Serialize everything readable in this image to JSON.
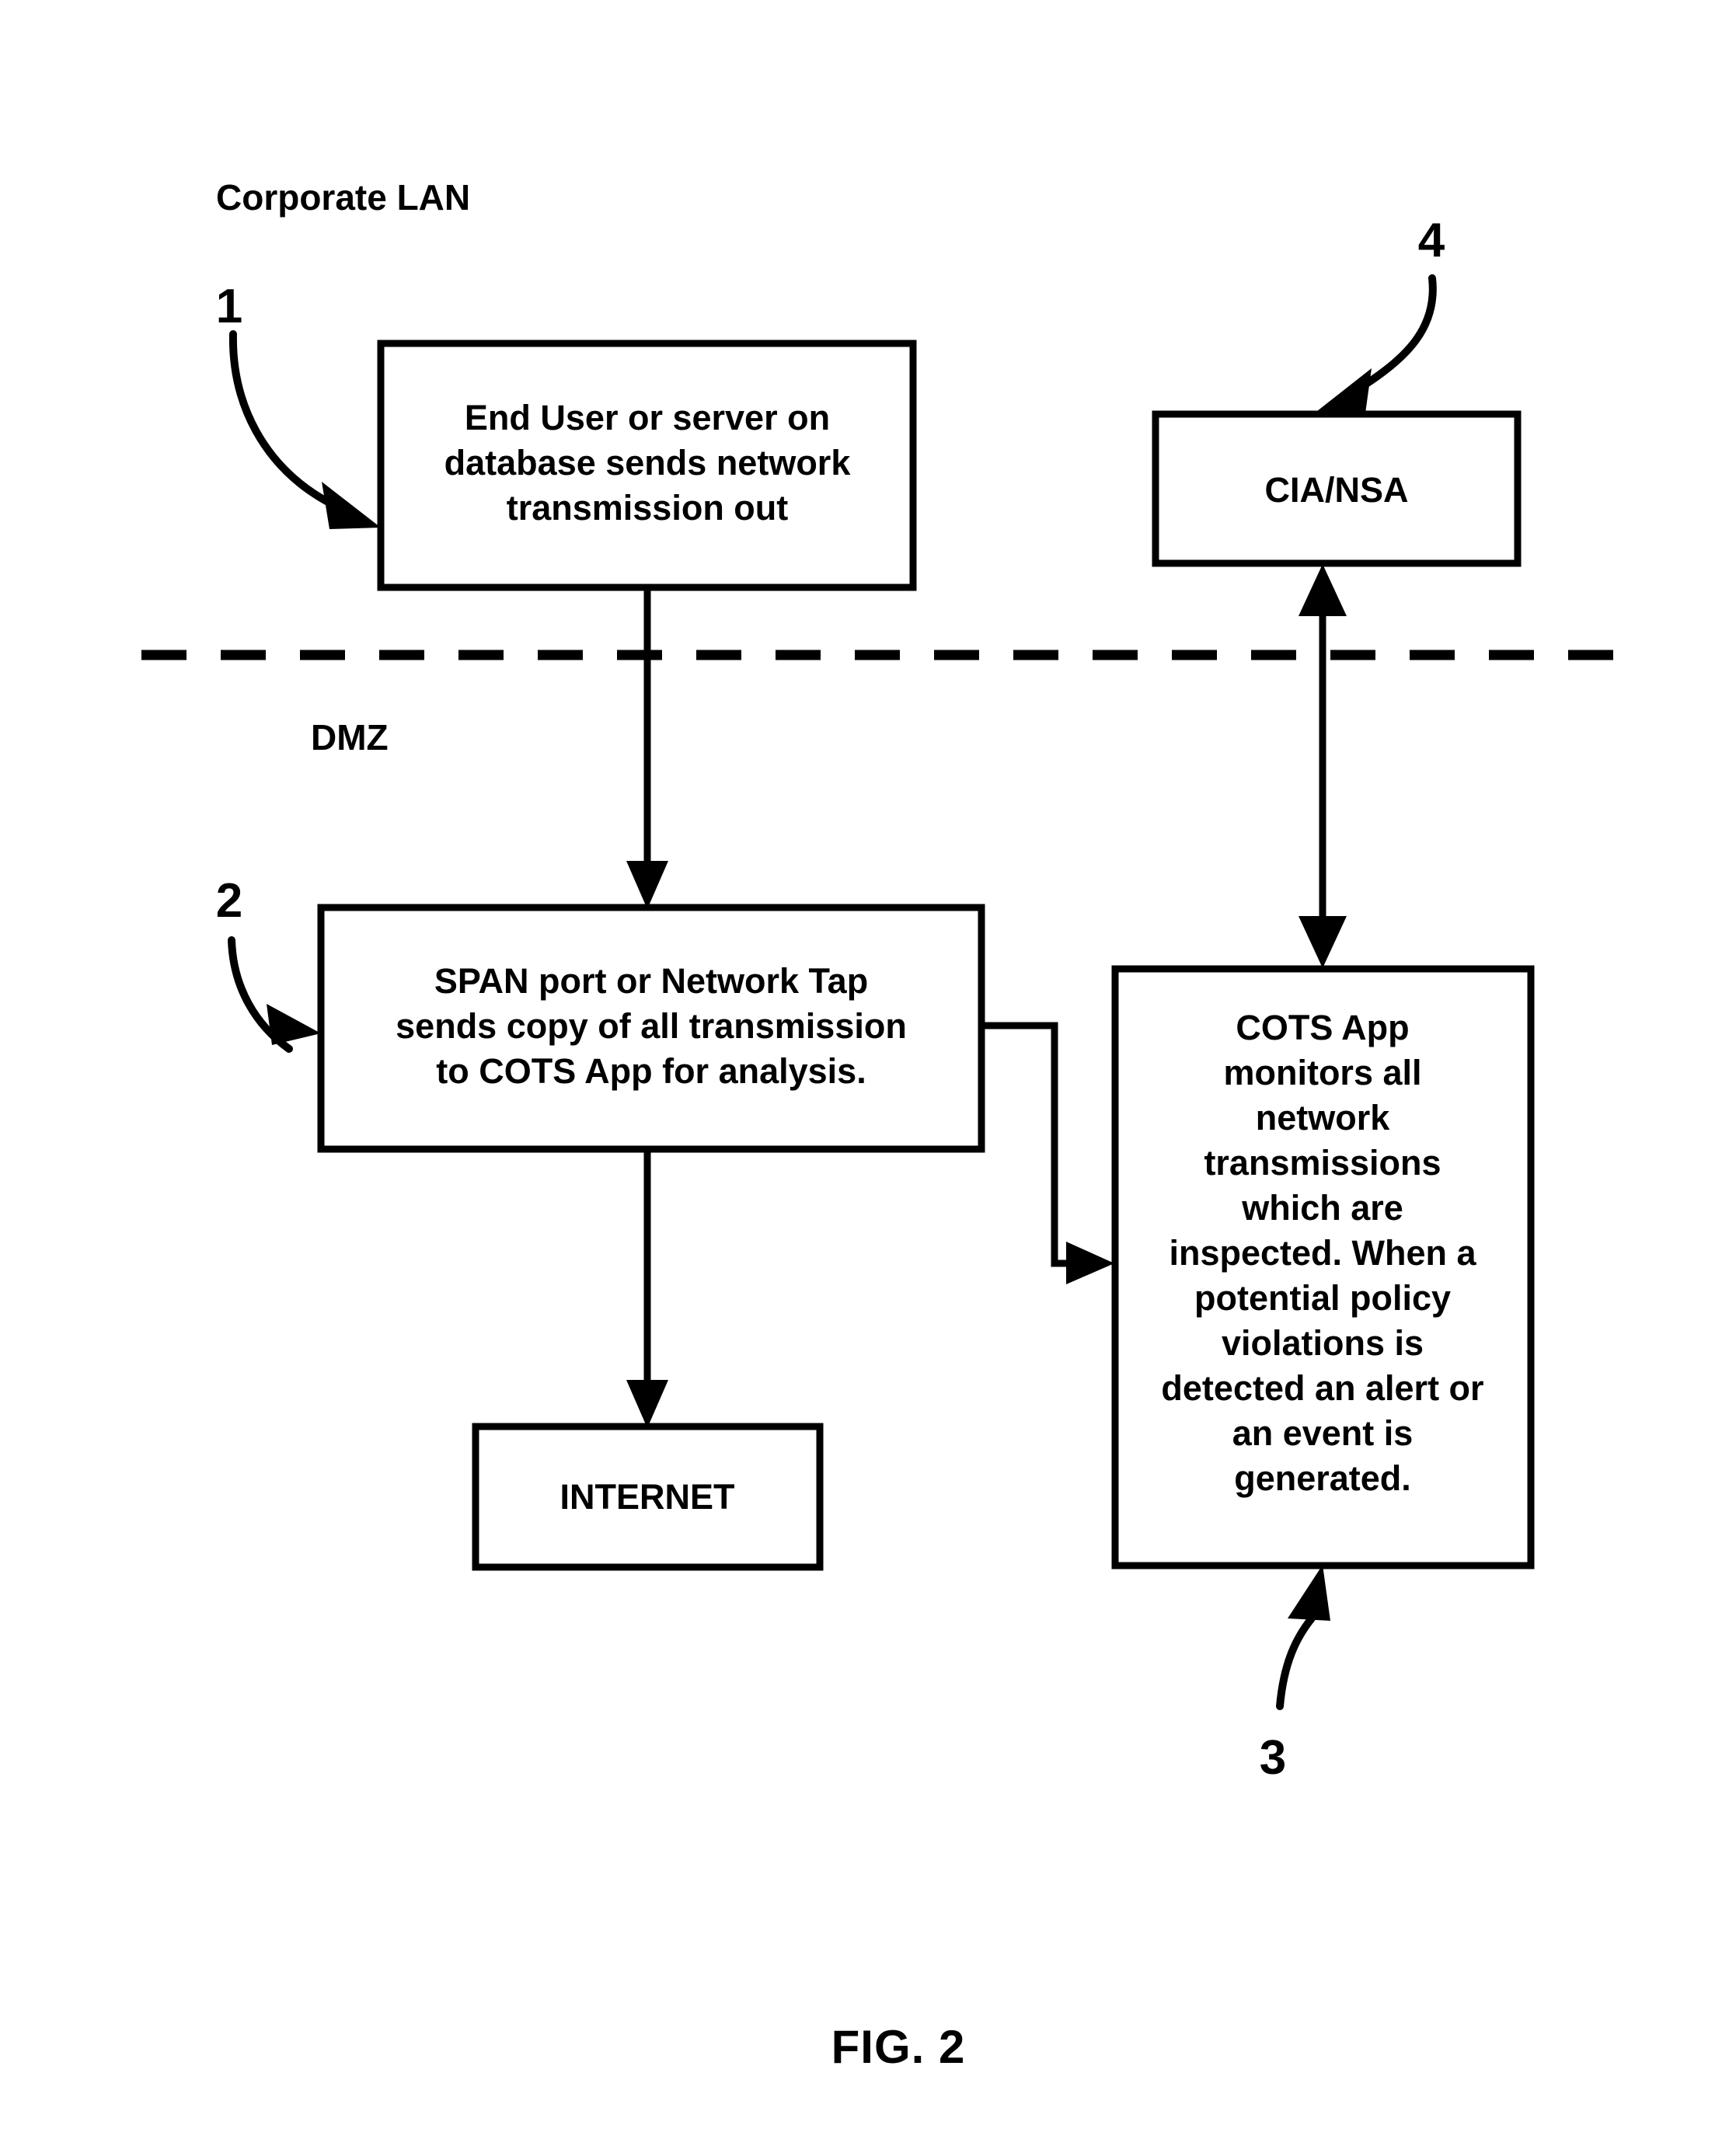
{
  "figure": {
    "caption": "FIG. 2",
    "zones": {
      "top_label": "Corporate LAN",
      "bottom_label": "DMZ"
    },
    "reference_numerals": {
      "one": "1",
      "two": "2",
      "three": "3",
      "four": "4"
    },
    "boxes": {
      "end_user": {
        "name": "end-user-box",
        "lines": [
          "End User or server on",
          "database sends network",
          "transmission out"
        ]
      },
      "cia_nsa": {
        "name": "cia-nsa-box",
        "lines": [
          "CIA/NSA"
        ]
      },
      "span_port": {
        "name": "span-port-box",
        "lines": [
          "SPAN port or Network Tap",
          "sends copy of all transmission",
          "to COTS App for analysis."
        ]
      },
      "internet": {
        "name": "internet-box",
        "lines": [
          "INTERNET"
        ]
      },
      "cots_app": {
        "name": "cots-app-box",
        "lines": [
          "COTS App",
          "monitors all",
          "network",
          "transmissions",
          "which are",
          "inspected. When a",
          "potential policy",
          "violations is",
          "detected an alert or",
          "an event is",
          "generated."
        ]
      }
    },
    "colors": {
      "stroke": "#000000",
      "fill": "#ffffff",
      "background": "#ffffff"
    }
  }
}
